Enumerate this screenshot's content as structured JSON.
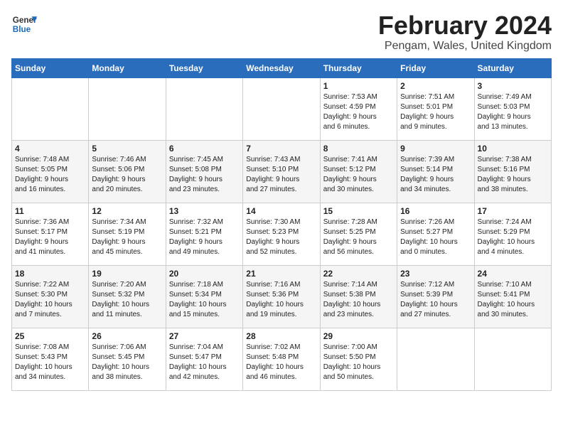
{
  "header": {
    "logo_general": "General",
    "logo_blue": "Blue",
    "title": "February 2024",
    "subtitle": "Pengam, Wales, United Kingdom"
  },
  "days_of_week": [
    "Sunday",
    "Monday",
    "Tuesday",
    "Wednesday",
    "Thursday",
    "Friday",
    "Saturday"
  ],
  "weeks": [
    [
      {
        "day": "",
        "info": ""
      },
      {
        "day": "",
        "info": ""
      },
      {
        "day": "",
        "info": ""
      },
      {
        "day": "",
        "info": ""
      },
      {
        "day": "1",
        "info": "Sunrise: 7:53 AM\nSunset: 4:59 PM\nDaylight: 9 hours\nand 6 minutes."
      },
      {
        "day": "2",
        "info": "Sunrise: 7:51 AM\nSunset: 5:01 PM\nDaylight: 9 hours\nand 9 minutes."
      },
      {
        "day": "3",
        "info": "Sunrise: 7:49 AM\nSunset: 5:03 PM\nDaylight: 9 hours\nand 13 minutes."
      }
    ],
    [
      {
        "day": "4",
        "info": "Sunrise: 7:48 AM\nSunset: 5:05 PM\nDaylight: 9 hours\nand 16 minutes."
      },
      {
        "day": "5",
        "info": "Sunrise: 7:46 AM\nSunset: 5:06 PM\nDaylight: 9 hours\nand 20 minutes."
      },
      {
        "day": "6",
        "info": "Sunrise: 7:45 AM\nSunset: 5:08 PM\nDaylight: 9 hours\nand 23 minutes."
      },
      {
        "day": "7",
        "info": "Sunrise: 7:43 AM\nSunset: 5:10 PM\nDaylight: 9 hours\nand 27 minutes."
      },
      {
        "day": "8",
        "info": "Sunrise: 7:41 AM\nSunset: 5:12 PM\nDaylight: 9 hours\nand 30 minutes."
      },
      {
        "day": "9",
        "info": "Sunrise: 7:39 AM\nSunset: 5:14 PM\nDaylight: 9 hours\nand 34 minutes."
      },
      {
        "day": "10",
        "info": "Sunrise: 7:38 AM\nSunset: 5:16 PM\nDaylight: 9 hours\nand 38 minutes."
      }
    ],
    [
      {
        "day": "11",
        "info": "Sunrise: 7:36 AM\nSunset: 5:17 PM\nDaylight: 9 hours\nand 41 minutes."
      },
      {
        "day": "12",
        "info": "Sunrise: 7:34 AM\nSunset: 5:19 PM\nDaylight: 9 hours\nand 45 minutes."
      },
      {
        "day": "13",
        "info": "Sunrise: 7:32 AM\nSunset: 5:21 PM\nDaylight: 9 hours\nand 49 minutes."
      },
      {
        "day": "14",
        "info": "Sunrise: 7:30 AM\nSunset: 5:23 PM\nDaylight: 9 hours\nand 52 minutes."
      },
      {
        "day": "15",
        "info": "Sunrise: 7:28 AM\nSunset: 5:25 PM\nDaylight: 9 hours\nand 56 minutes."
      },
      {
        "day": "16",
        "info": "Sunrise: 7:26 AM\nSunset: 5:27 PM\nDaylight: 10 hours\nand 0 minutes."
      },
      {
        "day": "17",
        "info": "Sunrise: 7:24 AM\nSunset: 5:29 PM\nDaylight: 10 hours\nand 4 minutes."
      }
    ],
    [
      {
        "day": "18",
        "info": "Sunrise: 7:22 AM\nSunset: 5:30 PM\nDaylight: 10 hours\nand 7 minutes."
      },
      {
        "day": "19",
        "info": "Sunrise: 7:20 AM\nSunset: 5:32 PM\nDaylight: 10 hours\nand 11 minutes."
      },
      {
        "day": "20",
        "info": "Sunrise: 7:18 AM\nSunset: 5:34 PM\nDaylight: 10 hours\nand 15 minutes."
      },
      {
        "day": "21",
        "info": "Sunrise: 7:16 AM\nSunset: 5:36 PM\nDaylight: 10 hours\nand 19 minutes."
      },
      {
        "day": "22",
        "info": "Sunrise: 7:14 AM\nSunset: 5:38 PM\nDaylight: 10 hours\nand 23 minutes."
      },
      {
        "day": "23",
        "info": "Sunrise: 7:12 AM\nSunset: 5:39 PM\nDaylight: 10 hours\nand 27 minutes."
      },
      {
        "day": "24",
        "info": "Sunrise: 7:10 AM\nSunset: 5:41 PM\nDaylight: 10 hours\nand 30 minutes."
      }
    ],
    [
      {
        "day": "25",
        "info": "Sunrise: 7:08 AM\nSunset: 5:43 PM\nDaylight: 10 hours\nand 34 minutes."
      },
      {
        "day": "26",
        "info": "Sunrise: 7:06 AM\nSunset: 5:45 PM\nDaylight: 10 hours\nand 38 minutes."
      },
      {
        "day": "27",
        "info": "Sunrise: 7:04 AM\nSunset: 5:47 PM\nDaylight: 10 hours\nand 42 minutes."
      },
      {
        "day": "28",
        "info": "Sunrise: 7:02 AM\nSunset: 5:48 PM\nDaylight: 10 hours\nand 46 minutes."
      },
      {
        "day": "29",
        "info": "Sunrise: 7:00 AM\nSunset: 5:50 PM\nDaylight: 10 hours\nand 50 minutes."
      },
      {
        "day": "",
        "info": ""
      },
      {
        "day": "",
        "info": ""
      }
    ]
  ]
}
